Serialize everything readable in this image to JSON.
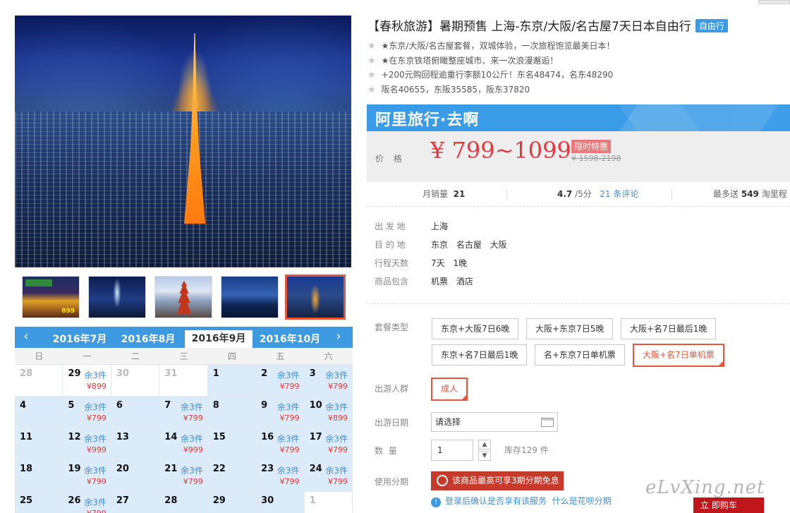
{
  "gallery": {
    "thumb_price": "899"
  },
  "calendar": {
    "months": [
      "2016年7月",
      "2016年8月",
      "2016年9月",
      "2016年10月"
    ],
    "active_month": "2016年9月",
    "weekdays": [
      "日",
      "一",
      "二",
      "三",
      "四",
      "五",
      "六"
    ],
    "rows": [
      [
        {
          "day": "28"
        },
        {
          "day": "29",
          "stock": "余3件",
          "price": "¥899",
          "cur": true
        },
        {
          "day": "30"
        },
        {
          "day": "31"
        },
        {
          "day": "1",
          "avail": true
        },
        {
          "day": "2",
          "stock": "余3件",
          "price": "¥799",
          "avail": true
        },
        {
          "day": "3",
          "stock": "余3件",
          "price": "¥799",
          "avail": true
        }
      ],
      [
        {
          "day": "4",
          "avail": true
        },
        {
          "day": "5",
          "stock": "余3件",
          "price": "¥799",
          "avail": true
        },
        {
          "day": "6",
          "avail": true
        },
        {
          "day": "7",
          "stock": "余3件",
          "price": "¥799",
          "avail": true
        },
        {
          "day": "8",
          "avail": true
        },
        {
          "day": "9",
          "stock": "余3件",
          "price": "¥799",
          "avail": true
        },
        {
          "day": "10",
          "stock": "余3件",
          "price": "¥899",
          "avail": true
        }
      ],
      [
        {
          "day": "11",
          "avail": true
        },
        {
          "day": "12",
          "stock": "余3件",
          "price": "¥999",
          "avail": true
        },
        {
          "day": "13",
          "avail": true
        },
        {
          "day": "14",
          "stock": "余3件",
          "price": "¥999",
          "avail": true
        },
        {
          "day": "15",
          "avail": true
        },
        {
          "day": "16",
          "stock": "余3件",
          "price": "¥799",
          "avail": true
        },
        {
          "day": "17",
          "stock": "余3件",
          "price": "¥799",
          "avail": true
        }
      ],
      [
        {
          "day": "18",
          "avail": true
        },
        {
          "day": "19",
          "stock": "余3件",
          "price": "¥799",
          "avail": true
        },
        {
          "day": "20",
          "avail": true
        },
        {
          "day": "21",
          "stock": "余3件",
          "price": "¥799",
          "avail": true
        },
        {
          "day": "22",
          "avail": true
        },
        {
          "day": "23",
          "stock": "余3件",
          "price": "¥799",
          "avail": true
        },
        {
          "day": "24",
          "stock": "余3件",
          "price": "¥799",
          "avail": true
        }
      ],
      [
        {
          "day": "25",
          "avail": true
        },
        {
          "day": "26",
          "stock": "余3件",
          "price": "¥799",
          "avail": true
        },
        {
          "day": "27",
          "avail": true
        },
        {
          "day": "28",
          "avail": true
        },
        {
          "day": "29",
          "avail": true
        },
        {
          "day": "30",
          "avail": true
        },
        {
          "day": "1"
        }
      ]
    ]
  },
  "product": {
    "title": "【春秋旅游】暑期预售 上海-东京/大阪/名古屋7天日本自由行",
    "type_tag": "自由行",
    "features": [
      "★东京/大阪/名古屋套餐，双城体验，一次旅程饱览最美日本！",
      "★在东京铁塔俯瞰整座城市、来一次浪漫邂逅！",
      "+200元购回程逾重行李额10公斤！东名48474，名东48290",
      "阪名40655，东阪35585，阪东37820"
    ]
  },
  "price_box": {
    "brand": "阿里旅行·去啊",
    "label": "价格",
    "price": "¥ 799~1099",
    "promo_tag": "限时特惠",
    "old_price": "¥ 1598-2198"
  },
  "stats": {
    "monthly_sales_label": "月销量",
    "monthly_sales": "21",
    "rating": "4.7",
    "rating_suffix": "/5分",
    "reviews_link": "21 条评论",
    "mileage_prefix": "最多送",
    "mileage": "549",
    "mileage_suffix": "淘里程"
  },
  "info": [
    {
      "key": "出 发 地",
      "value": "上海"
    },
    {
      "key": "目 的 地",
      "value": "东京 名古屋 大阪"
    },
    {
      "key": "行程天数",
      "value": "7天 1晚"
    },
    {
      "key": "商品包含",
      "value": "机票 酒店"
    }
  ],
  "options": {
    "package_label": "套餐类型",
    "packages": [
      "东京+大阪7日6晚",
      "大阪+东京7日5晚",
      "大阪+名7日最后1晚",
      "东京+名7日最后1晚",
      "名+东京7日单机票",
      "大阪+名7日单机票"
    ],
    "selected_package": "大阪+名7日单机票",
    "people_label": "出游人群",
    "people_option": "成人",
    "date_label": "出游日期",
    "date_placeholder": "请选择",
    "qty_label": "数 量",
    "qty_value": "1",
    "stock_text": "库存129 件",
    "installment_label": "使用分期",
    "installment_text": "该商品最高可享3期分期免息",
    "login_tip": "登录后确认是否享有该服务",
    "login_link": "什么是花呗分期"
  },
  "watermark": "eLvXing.net",
  "cart_fragment": "立 即购车"
}
